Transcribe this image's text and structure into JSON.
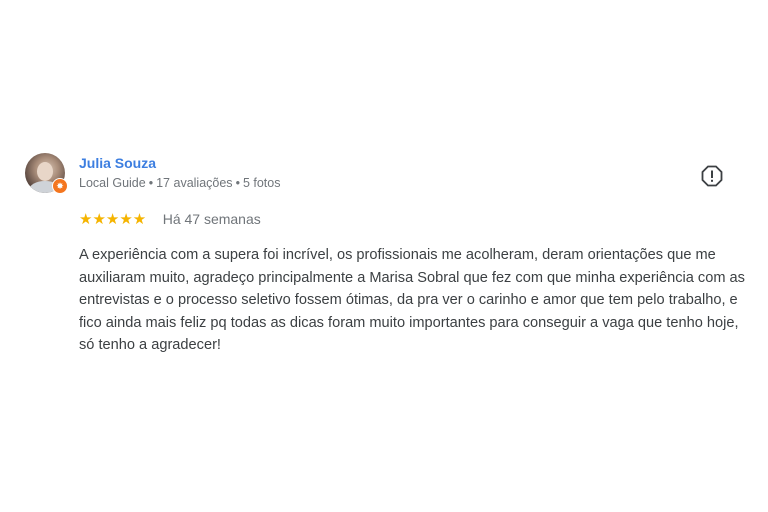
{
  "review": {
    "author": "Julia Souza",
    "meta": {
      "level": "Local Guide",
      "reviews": "17 avaliações",
      "photos": "5 fotos"
    },
    "rating": 5,
    "stars_text": "★★★★★",
    "time_ago": "Há 47 semanas",
    "text": "A experiência com a supera foi incrível, os profissionais me acolheram, deram orientações que me auxiliaram muito, agradeço principalmente a Marisa Sobral que fez com que minha experiência com as entrevistas e o processo seletivo fossem ótimas, da pra ver o carinho e amor que tem pelo trabalho, e fico ainda mais feliz pq todas as dicas foram muito importantes para conseguir a vaga que tenho hoje, só tenho a agradecer!",
    "badge_glyph": "✸",
    "colors": {
      "name": "#3c7ee0",
      "stars": "#f5b400",
      "badge": "#f4761f",
      "text": "#3c4043",
      "meta": "#70757a"
    },
    "icons": {
      "report": "report-flag-icon",
      "badge": "local-guide-badge-icon"
    }
  }
}
